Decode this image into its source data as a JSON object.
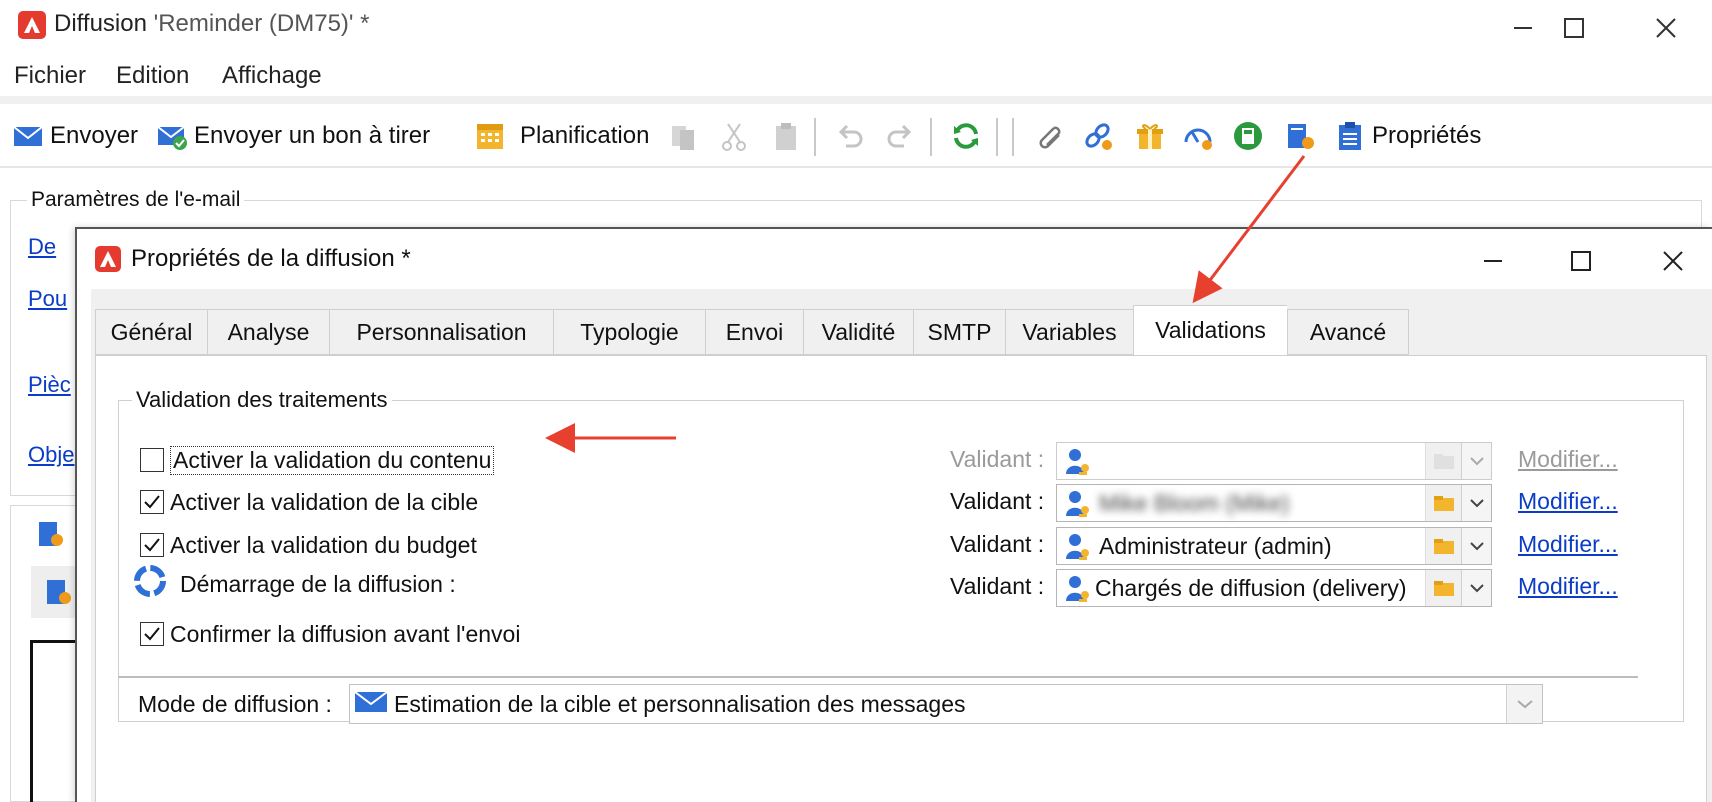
{
  "window": {
    "app_name": "Diffusion",
    "doc_title": "'Reminder (DM75)' *"
  },
  "menu": {
    "items": [
      "Fichier",
      "Edition",
      "Affichage"
    ]
  },
  "toolbar": {
    "send_label": "Envoyer",
    "proof_label": "Envoyer un bon à tirer",
    "schedule_label": "Planification",
    "properties_label": "Propriétés"
  },
  "email_params": {
    "title": "Paramètres de l'e-mail",
    "links": [
      "De",
      "Pou",
      "Pièc",
      "Obje"
    ]
  },
  "dialog": {
    "title": "Propriétés de la diffusion *",
    "tabs": [
      {
        "label": "Général",
        "active": false
      },
      {
        "label": "Analyse",
        "active": false
      },
      {
        "label": "Personnalisation",
        "active": false
      },
      {
        "label": "Typologie",
        "active": false
      },
      {
        "label": "Envoi",
        "active": false
      },
      {
        "label": "Validité",
        "active": false
      },
      {
        "label": "SMTP",
        "active": false
      },
      {
        "label": "Variables",
        "active": false
      },
      {
        "label": "Validations",
        "active": true
      },
      {
        "label": "Avancé",
        "active": false
      }
    ],
    "group_title": "Validation des traitements",
    "rows": [
      {
        "label": "Activer la validation du contenu",
        "checked": false,
        "validator_label": "Validant :",
        "validator": "",
        "enabled": false,
        "modify": "Modifier..."
      },
      {
        "label": "Activer la validation de la cible",
        "checked": true,
        "validator_label": "Validant :",
        "validator": "Mike Bloom (Mike)",
        "enabled": true,
        "modify": "Modifier..."
      },
      {
        "label": "Activer la validation du budget",
        "checked": true,
        "validator_label": "Validant :",
        "validator": "Administrateur (admin)",
        "enabled": true,
        "modify": "Modifier..."
      },
      {
        "label": "Démarrage de la diffusion :",
        "checked": null,
        "validator_label": "Validant :",
        "validator": "Chargés de diffusion (delivery)",
        "enabled": true,
        "modify": "Modifier..."
      }
    ],
    "confirm_label": "Confirmer la diffusion avant l'envoi",
    "confirm_checked": true,
    "mode_label": "Mode de diffusion :",
    "mode_value": "Estimation de la cible et personnalisation des messages"
  },
  "colors": {
    "accent_red": "#e53a2f",
    "link_blue": "#0a3cc7",
    "annotation_arrow": "#e8402e"
  }
}
